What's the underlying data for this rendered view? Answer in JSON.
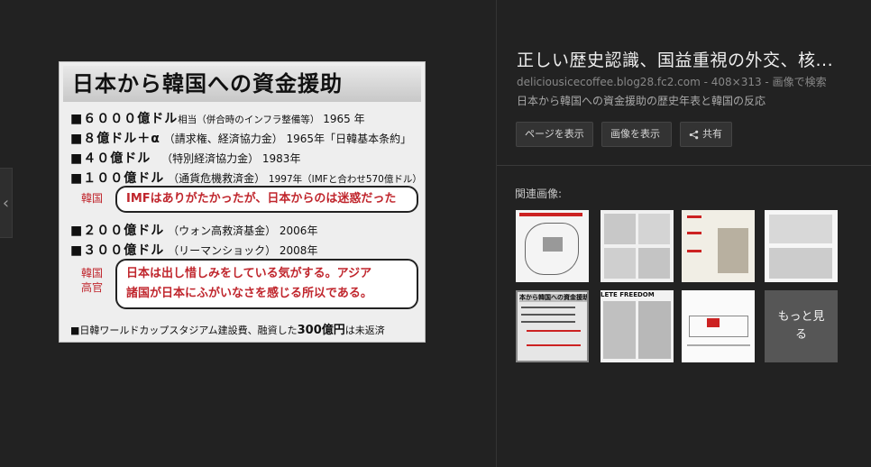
{
  "preview": {
    "title": "日本から韓国への資金援助",
    "rows": [
      {
        "amount": "■６０００億ドル",
        "note": "相当（併合時のインフラ整備等）",
        "year": "1965 年"
      },
      {
        "amount": "■８億ドル＋α",
        "note": "（請求権、経済協力金）",
        "year": "1965年「日韓基本条約」"
      },
      {
        "amount": "■４０億ドル",
        "note": "（特別経済協力金）",
        "year": "1983年"
      },
      {
        "amount": "■１００億ドル",
        "note": "（通貨危機救済金）",
        "year": "1997年（IMFと合わせ570億ドル）"
      },
      {
        "amount": "■２００億ドル",
        "note": "（ウォン高救済基金）",
        "year": "2006年"
      },
      {
        "amount": "■３００億ドル",
        "note": "（リーマンショック）",
        "year": "2008年"
      }
    ],
    "speaker1": "韓国",
    "bubble1": "IMFはありがたかったが、日本からのは迷惑だった",
    "speaker2_line1": "韓国",
    "speaker2_line2": "高官",
    "bubble2_line1": "日本は出し惜しみをしている気がする。アジア",
    "bubble2_line2": "諸国が日本にふがいなさを感じる所以である。",
    "footer_pre": "■日韓ワールドカップスタジアム建設費、融資した",
    "footer_bold": "300億円",
    "footer_post": "は未返済"
  },
  "details": {
    "title": "正しい歴史認識、国益重視の外交、核...",
    "meta": "deliciousicecoffee.blog28.fc2.com - 408×313 - 画像で検索",
    "description": "日本から韓国への資金援助の歴史年表と韓国の反応",
    "visit_button": "ページを表示",
    "view_button": "画像を表示",
    "share_button": "共有",
    "related_label": "関連画像:",
    "more_label_line1": "もっと見",
    "more_label_line2": "る"
  },
  "thumbs": {
    "t5_title": "本から韓国への資金援助",
    "t6_title": "LETE FREEDOM"
  },
  "icons": {
    "prev": "chevron-left-icon",
    "share": "share-icon"
  },
  "colors": {
    "background": "#222222",
    "accent_red": "#c0262d"
  }
}
